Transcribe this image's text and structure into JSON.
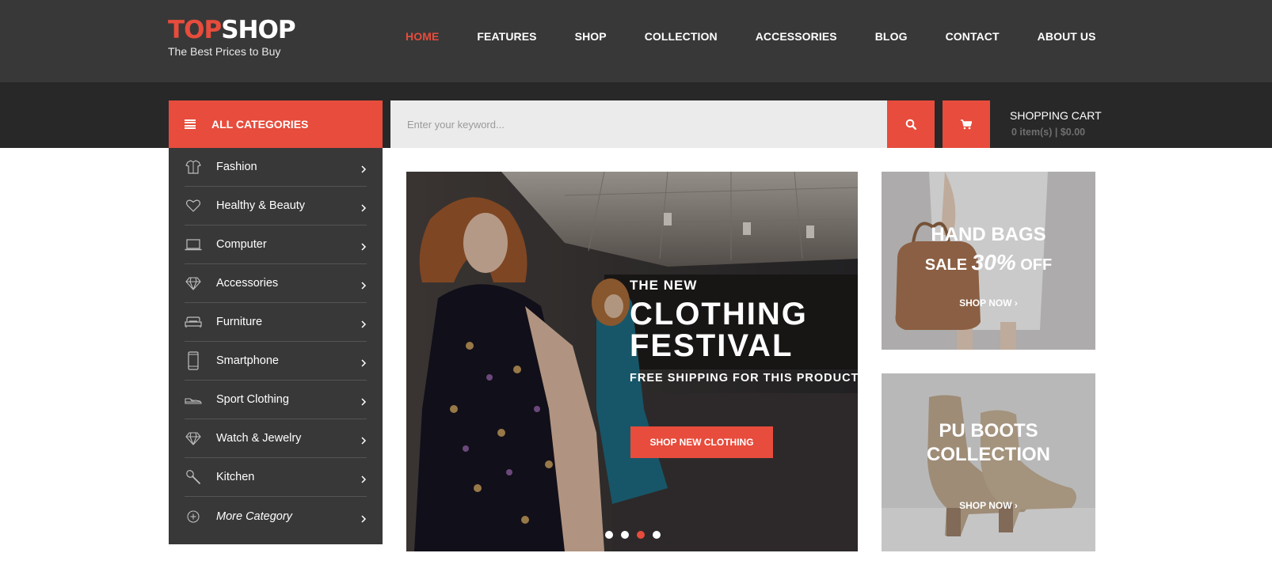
{
  "brand": {
    "name_part1": "TOP",
    "name_part2": "SHOP",
    "tagline": "The Best Prices to Buy",
    "accent_color": "#e74c3c"
  },
  "nav": {
    "items": [
      {
        "label": "HOME",
        "active": true
      },
      {
        "label": "FEATURES"
      },
      {
        "label": "SHOP"
      },
      {
        "label": "COLLECTION"
      },
      {
        "label": "ACCESSORIES"
      },
      {
        "label": "BLOG"
      },
      {
        "label": "CONTACT"
      },
      {
        "label": "ABOUT US"
      }
    ]
  },
  "categories": {
    "header": "ALL CATEGORIES",
    "header_icon": "menu-icon",
    "items": [
      {
        "label": "Fashion",
        "icon": "shirt-icon"
      },
      {
        "label": "Healthy & Beauty",
        "icon": "heart-icon"
      },
      {
        "label": "Computer",
        "icon": "laptop-icon"
      },
      {
        "label": "Accessories",
        "icon": "diamond-icon"
      },
      {
        "label": "Furniture",
        "icon": "sofa-icon"
      },
      {
        "label": "Smartphone",
        "icon": "smartphone-icon"
      },
      {
        "label": "Sport Clothing",
        "icon": "sneaker-icon"
      },
      {
        "label": "Watch & Jewelry",
        "icon": "diamond-icon"
      },
      {
        "label": "Kitchen",
        "icon": "kitchen-spoon-icon"
      },
      {
        "label": "More Category",
        "icon": "plus-circle-icon"
      }
    ]
  },
  "search": {
    "placeholder": "Enter your keyword...",
    "button_icon": "search-icon"
  },
  "cart": {
    "icon": "cart-icon",
    "title": "SHOPPING CART",
    "summary": "0 item(s) | $0.00"
  },
  "hero": {
    "kicker": "THE NEW",
    "title_line1": "CLOTHING",
    "title_line2": "FESTIVAL",
    "subtitle": "FREE SHIPPING FOR THIS PRODUCT",
    "button": "SHOP NEW CLOTHING",
    "slides": 4,
    "active_slide": 3
  },
  "promos": {
    "bags": {
      "title": "HAND BAGS",
      "sale_prefix": "SALE",
      "sale_value": "30%",
      "sale_suffix": "OFF",
      "link": "SHOP NOW"
    },
    "boots": {
      "title_line1": "PU BOOTS",
      "title_line2": "COLLECTION",
      "link": "SHOP NOW"
    }
  }
}
